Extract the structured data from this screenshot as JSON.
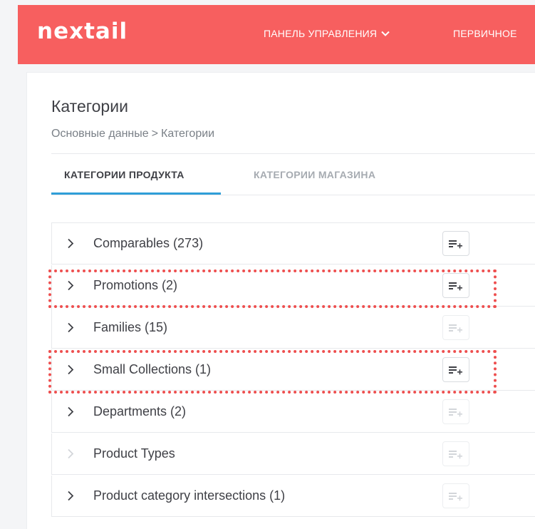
{
  "header": {
    "logo": "nextail",
    "nav": [
      {
        "label": "ПАНЕЛЬ УПРАВЛЕНИЯ",
        "has_dropdown": true
      },
      {
        "label": "ПЕРВИЧНОЕ",
        "has_dropdown": false
      }
    ],
    "colors": {
      "bar": "#f75f5f",
      "text": "#ffffff"
    }
  },
  "page": {
    "title": "Категории",
    "breadcrumb": {
      "parent": "Основные данные",
      "separator": ">",
      "current": "Категории"
    }
  },
  "tabs": [
    {
      "label": "КАТЕГОРИИ ПРОДУКТА",
      "active": true
    },
    {
      "label": "КАТЕГОРИИ МАГАЗИНА",
      "active": false
    }
  ],
  "categories": [
    {
      "label": "Comparables (273)",
      "expandable": true,
      "add_enabled": true,
      "highlighted": false
    },
    {
      "label": "Promotions (2)",
      "expandable": true,
      "add_enabled": true,
      "highlighted": true
    },
    {
      "label": "Families (15)",
      "expandable": true,
      "add_enabled": false,
      "highlighted": false
    },
    {
      "label": "Small Collections (1)",
      "expandable": true,
      "add_enabled": true,
      "highlighted": true
    },
    {
      "label": "Departments (2)",
      "expandable": true,
      "add_enabled": false,
      "highlighted": false
    },
    {
      "label": "Product Types",
      "expandable": false,
      "add_enabled": false,
      "highlighted": false
    },
    {
      "label": "Product category intersections (1)",
      "expandable": true,
      "add_enabled": false,
      "highlighted": false
    }
  ],
  "icons": {
    "expand": "chevron-right-icon",
    "add": "list-add-icon"
  },
  "accent_color": "#2f9ed8",
  "highlight_color": "#ee4f4f"
}
